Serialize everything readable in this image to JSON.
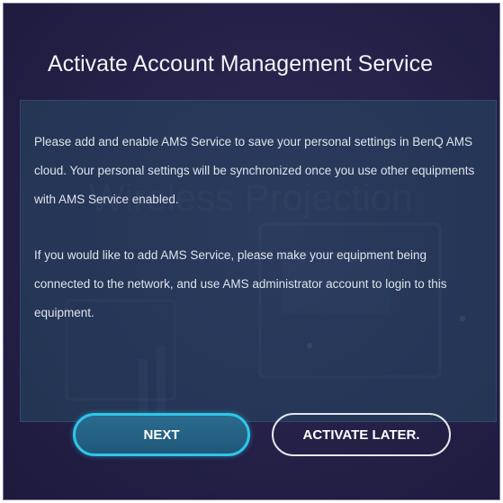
{
  "dialog": {
    "title": "Activate Account Management Service",
    "paragraphs": [
      "Please add and enable AMS Service to save your personal settings in BenQ AMS cloud. Your personal settings will be synchronized once you use other equipments with AMS Service enabled.",
      "If you would like to add AMS Service, please make your equipment being connected to the network, and use AMS administrator account to login to this equipment."
    ],
    "next_label": "NEXT",
    "later_label": "ACTIVATE LATER."
  },
  "colors": {
    "background": "#26224a",
    "panel": "#284864",
    "next_border": "#2ec6e8",
    "text": "#dfe3ea"
  }
}
